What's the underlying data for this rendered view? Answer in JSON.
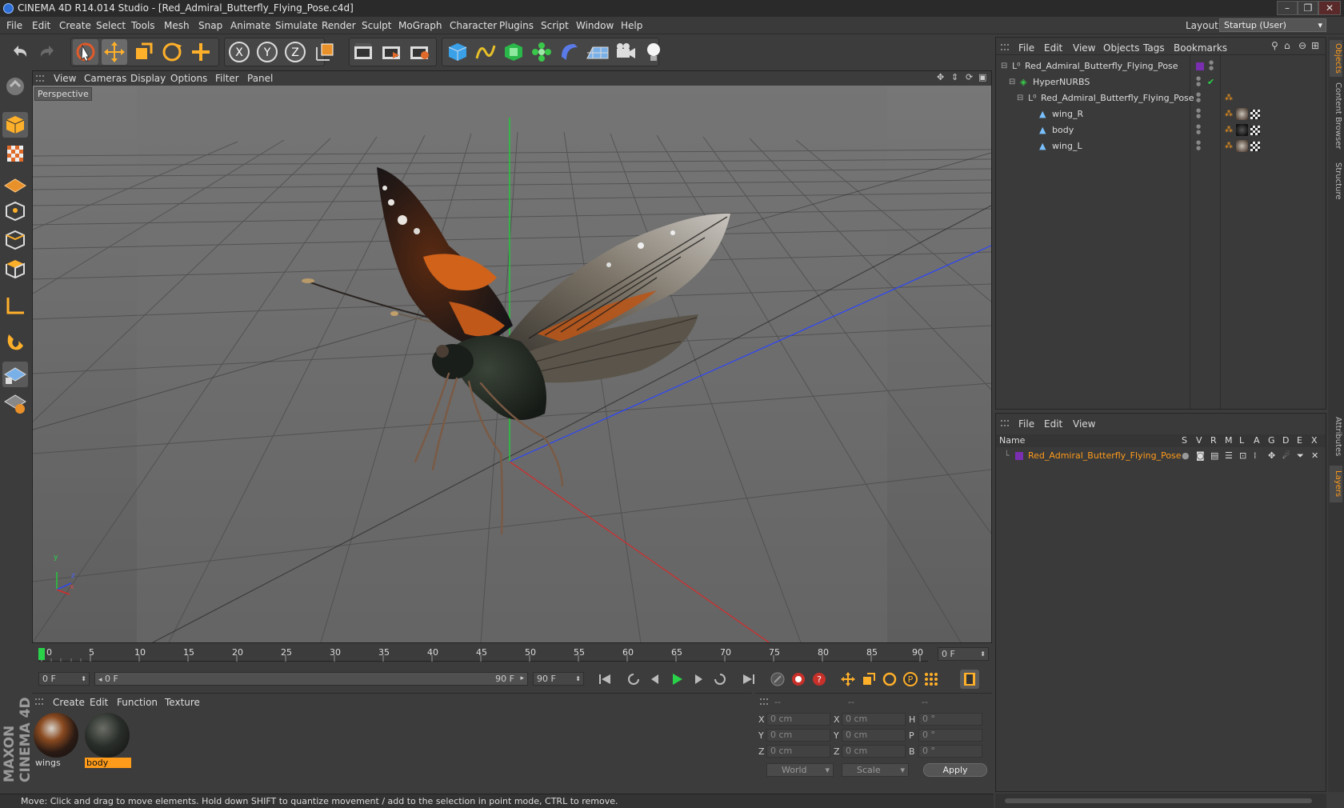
{
  "window": {
    "title": "CINEMA 4D R14.014 Studio - [Red_Admiral_Butterfly_Flying_Pose.c4d]",
    "minimize": "–",
    "maximize": "❐",
    "close": "✕"
  },
  "menubar": {
    "items": [
      "File",
      "Edit",
      "Create",
      "Select",
      "Tools",
      "Mesh",
      "Snap",
      "Animate",
      "Simulate",
      "Render",
      "Sculpt",
      "MoGraph",
      "Character",
      "Plugins",
      "Script",
      "Window",
      "Help"
    ],
    "layout_label": "Layout:",
    "layout_value": "Startup (User)"
  },
  "toolbar": {
    "icons": [
      "undo-icon",
      "redo-icon",
      "live-selection-icon",
      "move-icon",
      "scale-icon",
      "rotate-icon",
      "add-icon",
      "x-axis-icon",
      "y-axis-icon",
      "z-axis-icon",
      "world-coordinates-icon",
      "render-view-icon",
      "render-picture-viewer-icon",
      "edit-render-settings-icon",
      "cube-icon",
      "spline-icon",
      "nurbs-icon",
      "array-icon",
      "deformer-icon",
      "floor-icon",
      "camera-icon",
      "light-icon"
    ]
  },
  "viewport": {
    "menu": [
      "View",
      "Cameras",
      "Display",
      "Options",
      "Filter",
      "Panel"
    ],
    "label": "Perspective",
    "axis_y": "y",
    "axis_z": "z",
    "axis_x": "x"
  },
  "timeline": {
    "ticks": [
      "0",
      "5",
      "10",
      "15",
      "20",
      "25",
      "30",
      "35",
      "40",
      "45",
      "50",
      "55",
      "60",
      "65",
      "70",
      "75",
      "80",
      "85",
      "90"
    ],
    "current_frame": "0 F",
    "start_field": "0 F",
    "range_start": "0 F",
    "range_end": "90 F",
    "end_field": "90 F"
  },
  "materials": {
    "menu": [
      "Create",
      "Edit",
      "Function",
      "Texture"
    ],
    "items": [
      {
        "label": "wings",
        "selected": false
      },
      {
        "label": "body",
        "selected": true
      }
    ]
  },
  "coords": {
    "header": [
      "--",
      "--",
      "--"
    ],
    "rows": [
      {
        "l1": "X",
        "v1": "0 cm",
        "l2": "X",
        "v2": "0 cm",
        "l3": "H",
        "v3": "0 °"
      },
      {
        "l1": "Y",
        "v1": "0 cm",
        "l2": "Y",
        "v2": "0 cm",
        "l3": "P",
        "v3": "0 °"
      },
      {
        "l1": "Z",
        "v1": "0 cm",
        "l2": "Z",
        "v2": "0 cm",
        "l3": "B",
        "v3": "0 °"
      }
    ],
    "world": "World",
    "scale": "Scale",
    "apply": "Apply"
  },
  "status": {
    "text": "Move: Click and drag to move elements. Hold down SHIFT to quantize movement / add to the selection in point mode, CTRL to remove."
  },
  "object_manager": {
    "menu": [
      "File",
      "Edit",
      "View",
      "Objects",
      "Tags",
      "Bookmarks"
    ],
    "objects": [
      {
        "name": "Red_Admiral_Butterfly_Flying_Pose",
        "indent": 0
      },
      {
        "name": "HyperNURBS",
        "indent": 1
      },
      {
        "name": "Red_Admiral_Butterfly_Flying_Pose",
        "indent": 2
      },
      {
        "name": "wing_R",
        "indent": 3
      },
      {
        "name": "body",
        "indent": 3
      },
      {
        "name": "wing_L",
        "indent": 3
      }
    ]
  },
  "layer_manager": {
    "menu": [
      "File",
      "Edit",
      "View"
    ],
    "columns": [
      "Name",
      "S",
      "V",
      "R",
      "M",
      "L",
      "A",
      "G",
      "D",
      "E",
      "X"
    ],
    "layer_name": "Red_Admiral_Butterfly_Flying_Pose"
  },
  "side_tabs": [
    "Objects",
    "Content Browser",
    "Structure",
    "Attributes",
    "Layers"
  ],
  "brand": "MAXON CINEMA 4D",
  "colors": {
    "accent_orange": "#ff9b1a",
    "layer_purple": "#7a2fb0",
    "axis_green": "#22c93a",
    "axis_blue": "#2a44ff",
    "axis_red": "#d82a2a"
  }
}
